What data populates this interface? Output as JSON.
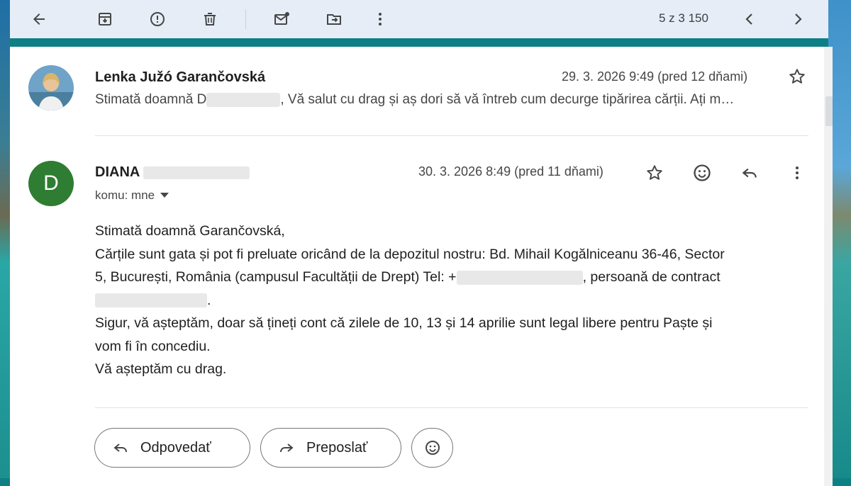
{
  "toolbar": {
    "count": "5 z 3 150",
    "icons": [
      "back-arrow-icon",
      "archive-icon",
      "report-spam-icon",
      "delete-icon",
      "mark-unread-icon",
      "move-to-icon",
      "more-vert-icon",
      "chevron-left-icon",
      "chevron-right-icon"
    ]
  },
  "messages": [
    {
      "sender": "Lenka Južó Garančovská",
      "date": "29. 3. 2026 9:49 (pred 12 dňami)",
      "snippet_start": "Stimată doamnă D",
      "snippet_rest": ", Vă salut cu drag și aș dori să vă întreb cum decurge tipărirea cărții. Ați m…"
    },
    {
      "avatar_letter": "D",
      "sender": "DIANA",
      "date": "30. 3. 2026 8:49 (pred 11 dňami)",
      "to": "komu: mne",
      "body": {
        "line1": "Stimată doamnă Garančovská,",
        "line2": "Cărțile sunt gata și pot fi preluate oricând de la depozitul nostru: Bd. Mihail Kogălniceanu 36-46, Sector",
        "line3_a": "5, București, România (campusul Facultății de Drept) Tel: +",
        "line3_b": ", persoană de contract",
        "line5": "Sigur, vă așteptăm, doar să țineți cont că zilele de 10, 13 și 14 aprilie sunt legal libere pentru Paște și",
        "line6": "vom fi în concediu.",
        "line7": "Vă așteptăm cu drag."
      }
    }
  ],
  "actions": {
    "reply": "Odpovedať",
    "forward": "Preposlať"
  },
  "colors": {
    "toolbar_bg": "#e7edf6",
    "avatar_green": "#2e7d32"
  }
}
